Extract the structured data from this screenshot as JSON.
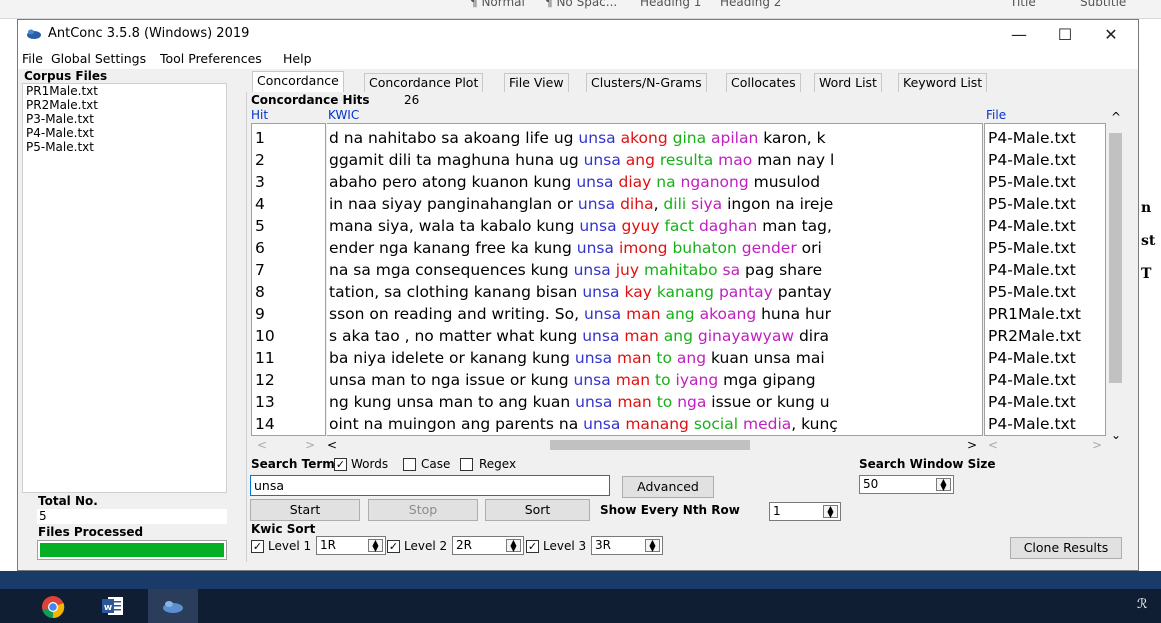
{
  "word_ribbon": {
    "styles": [
      "¶ Normal",
      "¶ No Spac...",
      "Heading 1",
      "Heading 2",
      "Title",
      "Subtitle"
    ],
    "side_letters": [
      "n",
      "st",
      "T"
    ]
  },
  "window": {
    "title": "AntConc 3.5.8 (Windows) 2019",
    "minimize": "—",
    "maximize": "☐",
    "close": "✕"
  },
  "menu": [
    "File",
    "Global Settings",
    "Tool Preferences",
    "Help"
  ],
  "corpus": {
    "header": "Corpus Files",
    "files": [
      "PR1Male.txt",
      "PR2Male.txt",
      "P3-Male.txt",
      "P4-Male.txt",
      "P5-Male.txt"
    ],
    "total_label": "Total No.",
    "total_value": "5",
    "processed_label": "Files Processed",
    "progress": 1.0
  },
  "tabs": [
    "Concordance",
    "Concordance Plot",
    "File View",
    "Clusters/N-Grams",
    "Collocates",
    "Word List",
    "Keyword List"
  ],
  "hits": {
    "label": "Concordance Hits",
    "count": "26",
    "col_hit": "Hit",
    "col_kwic": "KWIC",
    "col_file": "File"
  },
  "colors": {
    "blue": "#3333cc",
    "red": "#e01010",
    "green": "#18b018",
    "magenta": "#c020c0",
    "progress": "#06b025"
  },
  "rows": [
    {
      "n": "1",
      "segs": [
        [
          "d na nahitabo sa akoang life ug ",
          "k"
        ],
        [
          "unsa",
          "b"
        ],
        [
          " ",
          "k"
        ],
        [
          "akong",
          "r"
        ],
        [
          " ",
          "k"
        ],
        [
          "gina",
          "g"
        ],
        [
          " ",
          "k"
        ],
        [
          "apilan",
          "m"
        ],
        [
          " karon, k",
          "k"
        ]
      ],
      "file": "P4-Male.txt"
    },
    {
      "n": "2",
      "segs": [
        [
          "ggamit dili ta maghuna huna ug ",
          "k"
        ],
        [
          "unsa",
          "b"
        ],
        [
          " ",
          "k"
        ],
        [
          "ang",
          "r"
        ],
        [
          " ",
          "k"
        ],
        [
          "resulta",
          "g"
        ],
        [
          " ",
          "k"
        ],
        [
          "mao",
          "m"
        ],
        [
          " man nay l",
          "k"
        ]
      ],
      "file": "P4-Male.txt"
    },
    {
      "n": "3",
      "segs": [
        [
          "abaho pero atong kuanon kung ",
          "k"
        ],
        [
          "unsa",
          "b"
        ],
        [
          " ",
          "k"
        ],
        [
          "diay",
          "r"
        ],
        [
          " ",
          "k"
        ],
        [
          "na",
          "g"
        ],
        [
          " ",
          "k"
        ],
        [
          "nganong",
          "m"
        ],
        [
          " musulod",
          "k"
        ]
      ],
      "file": "P5-Male.txt"
    },
    {
      "n": "4",
      "segs": [
        [
          "in naa siyay panginahanglan or ",
          "k"
        ],
        [
          "unsa",
          "b"
        ],
        [
          " ",
          "k"
        ],
        [
          "diha",
          "r"
        ],
        [
          ", ",
          "k"
        ],
        [
          "dili",
          "g"
        ],
        [
          " ",
          "k"
        ],
        [
          "siya",
          "m"
        ],
        [
          " ingon na ireje",
          "k"
        ]
      ],
      "file": "P5-Male.txt"
    },
    {
      "n": "5",
      "segs": [
        [
          "mana siya, wala ta kabalo kung ",
          "k"
        ],
        [
          "unsa",
          "b"
        ],
        [
          " ",
          "k"
        ],
        [
          "gyuy",
          "r"
        ],
        [
          " ",
          "k"
        ],
        [
          "fact",
          "g"
        ],
        [
          " ",
          "k"
        ],
        [
          "daghan",
          "m"
        ],
        [
          " man tag,",
          "k"
        ]
      ],
      "file": "P4-Male.txt"
    },
    {
      "n": "6",
      "segs": [
        [
          "ender nga kanang free ka kung ",
          "k"
        ],
        [
          "unsa",
          "b"
        ],
        [
          " ",
          "k"
        ],
        [
          "imong",
          "r"
        ],
        [
          " ",
          "k"
        ],
        [
          "buhaton",
          "g"
        ],
        [
          " ",
          "k"
        ],
        [
          "gender",
          "m"
        ],
        [
          " ori",
          "k"
        ]
      ],
      "file": "P5-Male.txt"
    },
    {
      "n": "7",
      "segs": [
        [
          "na sa mga consequences kung ",
          "k"
        ],
        [
          "unsa",
          "b"
        ],
        [
          " ",
          "k"
        ],
        [
          "juy",
          "r"
        ],
        [
          " ",
          "k"
        ],
        [
          "mahitabo",
          "g"
        ],
        [
          " ",
          "k"
        ],
        [
          "sa",
          "m"
        ],
        [
          " pag share",
          "k"
        ]
      ],
      "file": "P4-Male.txt"
    },
    {
      "n": "8",
      "segs": [
        [
          "tation, sa clothing kanang bisan ",
          "k"
        ],
        [
          "unsa",
          "b"
        ],
        [
          " ",
          "k"
        ],
        [
          "kay",
          "r"
        ],
        [
          " ",
          "k"
        ],
        [
          "kanang",
          "g"
        ],
        [
          " ",
          "k"
        ],
        [
          "pantay",
          "m"
        ],
        [
          " pantay",
          "k"
        ]
      ],
      "file": "P5-Male.txt"
    },
    {
      "n": "9",
      "segs": [
        [
          "sson on reading and writing. So, ",
          "k"
        ],
        [
          "unsa",
          "b"
        ],
        [
          " ",
          "k"
        ],
        [
          "man",
          "r"
        ],
        [
          " ",
          "k"
        ],
        [
          "ang",
          "g"
        ],
        [
          " ",
          "k"
        ],
        [
          "akoang",
          "m"
        ],
        [
          " huna hur",
          "k"
        ]
      ],
      "file": "PR1Male.txt"
    },
    {
      "n": "10",
      "segs": [
        [
          "s aka tao , no matter what kung ",
          "k"
        ],
        [
          "unsa",
          "b"
        ],
        [
          " ",
          "k"
        ],
        [
          "man",
          "r"
        ],
        [
          " ",
          "k"
        ],
        [
          "ang",
          "g"
        ],
        [
          " ",
          "k"
        ],
        [
          "ginayawyaw",
          "m"
        ],
        [
          " dira",
          "k"
        ]
      ],
      "file": "PR2Male.txt"
    },
    {
      "n": "11",
      "segs": [
        [
          "ba niya idelete or kanang kung ",
          "k"
        ],
        [
          "unsa",
          "b"
        ],
        [
          " ",
          "k"
        ],
        [
          "man",
          "r"
        ],
        [
          " ",
          "k"
        ],
        [
          "to",
          "g"
        ],
        [
          " ",
          "k"
        ],
        [
          "ang",
          "m"
        ],
        [
          " kuan unsa mai",
          "k"
        ]
      ],
      "file": "P4-Male.txt"
    },
    {
      "n": "12",
      "segs": [
        [
          "unsa man to nga issue or kung ",
          "k"
        ],
        [
          "unsa",
          "b"
        ],
        [
          " ",
          "k"
        ],
        [
          "man",
          "r"
        ],
        [
          " ",
          "k"
        ],
        [
          "to",
          "g"
        ],
        [
          " ",
          "k"
        ],
        [
          "iyang",
          "m"
        ],
        [
          " mga gipang",
          "k"
        ]
      ],
      "file": "P4-Male.txt"
    },
    {
      "n": "13",
      "segs": [
        [
          "ng kung unsa man to ang kuan ",
          "k"
        ],
        [
          "unsa",
          "b"
        ],
        [
          " ",
          "k"
        ],
        [
          "man",
          "r"
        ],
        [
          " ",
          "k"
        ],
        [
          "to",
          "g"
        ],
        [
          " ",
          "k"
        ],
        [
          "nga",
          "m"
        ],
        [
          " issue or kung u",
          "k"
        ]
      ],
      "file": "P4-Male.txt"
    },
    {
      "n": "14",
      "segs": [
        [
          "oint na muingon ang parents na ",
          "k"
        ],
        [
          "unsa",
          "b"
        ],
        [
          " ",
          "k"
        ],
        [
          "manang",
          "r"
        ],
        [
          " ",
          "k"
        ],
        [
          "social",
          "g"
        ],
        [
          " ",
          "k"
        ],
        [
          "media",
          "m"
        ],
        [
          ", kunç",
          "k"
        ]
      ],
      "file": "P4-Male.txt"
    }
  ],
  "search": {
    "term_label": "Search Term",
    "words_label": "Words",
    "case_label": "Case",
    "regex_label": "Regex",
    "words_checked": "✓",
    "value": "unsa",
    "advanced": "Advanced",
    "window_label": "Search Window Size",
    "window_value": "50"
  },
  "controls": {
    "start": "Start",
    "stop": "Stop",
    "sort": "Sort",
    "nth_label": "Show Every Nth Row",
    "nth_value": "1",
    "kwic_sort": "Kwic Sort",
    "level1": "Level 1",
    "level1_value": "1R",
    "level2": "Level 2",
    "level2_value": "2R",
    "level3": "Level 3",
    "level3_value": "3R",
    "check": "✓",
    "clone": "Clone Results"
  },
  "scroll": {
    "up": "^",
    "down": "⌄",
    "left": "<",
    "right": ">"
  }
}
